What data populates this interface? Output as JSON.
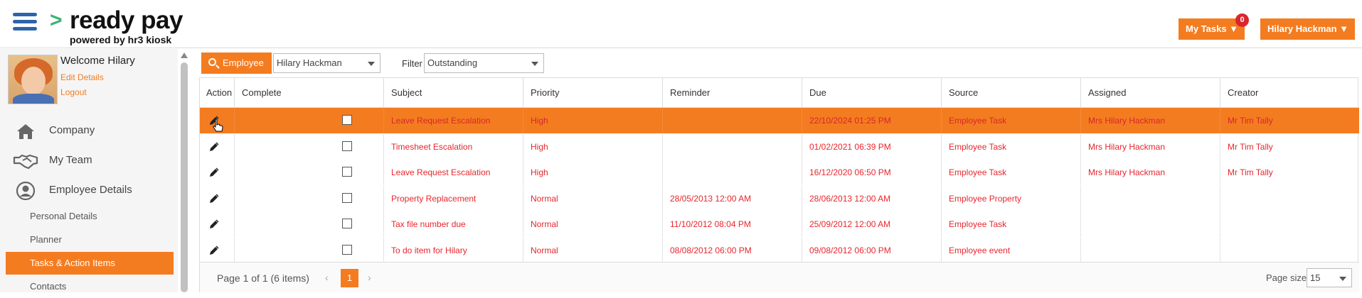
{
  "header": {
    "brand": "ready pay",
    "brand_mark": ">",
    "brand_sub": "powered by hr3 kiosk",
    "my_tasks_label": "My Tasks ▼",
    "my_tasks_count": "0",
    "user_label": "Hilary Hackman ▼"
  },
  "sidebar": {
    "welcome": "Welcome Hilary",
    "edit_details": "Edit Details",
    "logout": "Logout",
    "nav": [
      {
        "label": "Company",
        "icon": "home-icon"
      },
      {
        "label": "My Team",
        "icon": "handshake-icon"
      },
      {
        "label": "Employee Details",
        "icon": "user-circle-icon"
      }
    ],
    "sub_items": [
      "Personal Details",
      "Planner",
      "Tasks & Action Items",
      "Contacts"
    ]
  },
  "toolbar": {
    "employee_button": "Employee",
    "employee_value": "Hilary Hackman",
    "filter_label": "Filter",
    "filter_value": "Outstanding"
  },
  "grid": {
    "columns": [
      "Action",
      "Complete",
      "Subject",
      "Priority",
      "Reminder",
      "Due",
      "Source",
      "Assigned",
      "Creator"
    ],
    "rows": [
      {
        "subject": "Leave Request Escalation",
        "priority": "High",
        "reminder": "",
        "due": "22/10/2024 01:25 PM",
        "source": "Employee Task",
        "assigned": "Mrs Hilary Hackman",
        "creator": "Mr Tim Tally"
      },
      {
        "subject": "Timesheet Escalation",
        "priority": "High",
        "reminder": "",
        "due": "01/02/2021 06:39 PM",
        "source": "Employee Task",
        "assigned": "Mrs Hilary Hackman",
        "creator": "Mr Tim Tally"
      },
      {
        "subject": "Leave Request Escalation",
        "priority": "High",
        "reminder": "",
        "due": "16/12/2020 06:50 PM",
        "source": "Employee Task",
        "assigned": "Mrs Hilary Hackman",
        "creator": "Mr Tim Tally"
      },
      {
        "subject": "Property Replacement",
        "priority": "Normal",
        "reminder": "28/05/2013 12:00 AM",
        "due": "28/06/2013 12:00 AM",
        "source": "Employee Property",
        "assigned": "",
        "creator": ""
      },
      {
        "subject": "Tax file number due",
        "priority": "Normal",
        "reminder": "11/10/2012 08:04 PM",
        "due": "25/09/2012 12:00 AM",
        "source": "Employee Task",
        "assigned": "",
        "creator": ""
      },
      {
        "subject": "To do item for Hilary",
        "priority": "Normal",
        "reminder": "08/08/2012 06:00 PM",
        "due": "09/08/2012 06:00 PM",
        "source": "Employee event",
        "assigned": "",
        "creator": ""
      }
    ],
    "selected_row": 0
  },
  "pager": {
    "info": "Page 1 of 1 (6 items)",
    "prev": "‹",
    "next": "›",
    "current_page": "1",
    "page_size_label": "Page size:",
    "page_size": "15"
  },
  "colors": {
    "accent": "#f47c20",
    "text_red": "#e8262d",
    "brand_blue": "#2e64a8",
    "brand_green": "#3cb371"
  }
}
